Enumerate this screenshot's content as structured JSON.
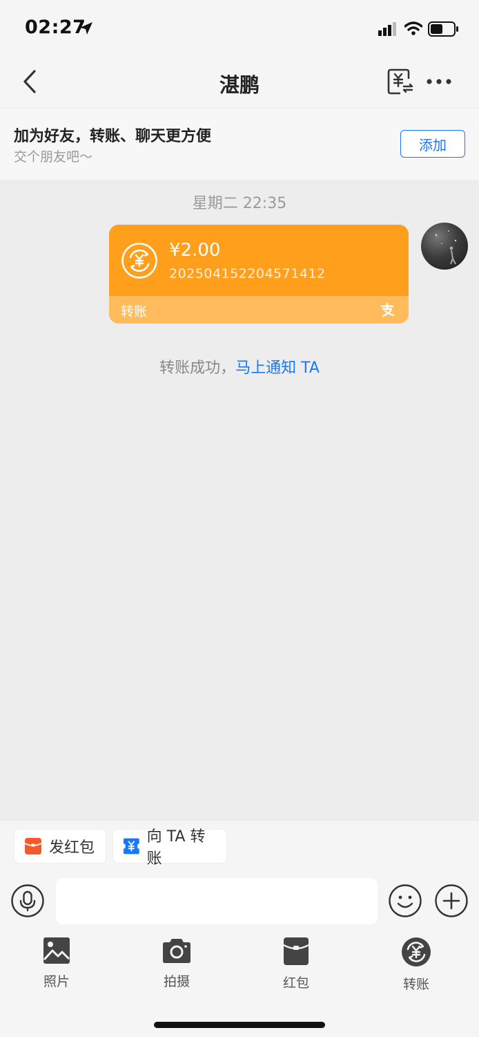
{
  "status_bar": {
    "time": "02:27"
  },
  "nav": {
    "title": "湛鹏"
  },
  "friend_banner": {
    "title": "加为好友，转账、聊天更方便",
    "subtitle": "交个朋友吧～",
    "add_label": "添加"
  },
  "chat": {
    "timestamp": "星期二 22:35",
    "transfer": {
      "amount": "¥2.00",
      "order_no": "202504152204571412",
      "label": "转账"
    },
    "notice": {
      "text": "转账成功，",
      "link": "马上通知 TA"
    }
  },
  "quick_actions": {
    "red_packet": "发红包",
    "transfer": "向 TA 转账"
  },
  "input": {
    "placeholder": ""
  },
  "toolbar": {
    "photo": "照片",
    "camera": "拍摄",
    "red_packet": "红包",
    "transfer": "转账"
  },
  "colors": {
    "card_orange": "#ff9f1c",
    "card_footer": "#ffbb5c",
    "link_blue": "#1677ff",
    "red_packet": "#f25a2c"
  }
}
